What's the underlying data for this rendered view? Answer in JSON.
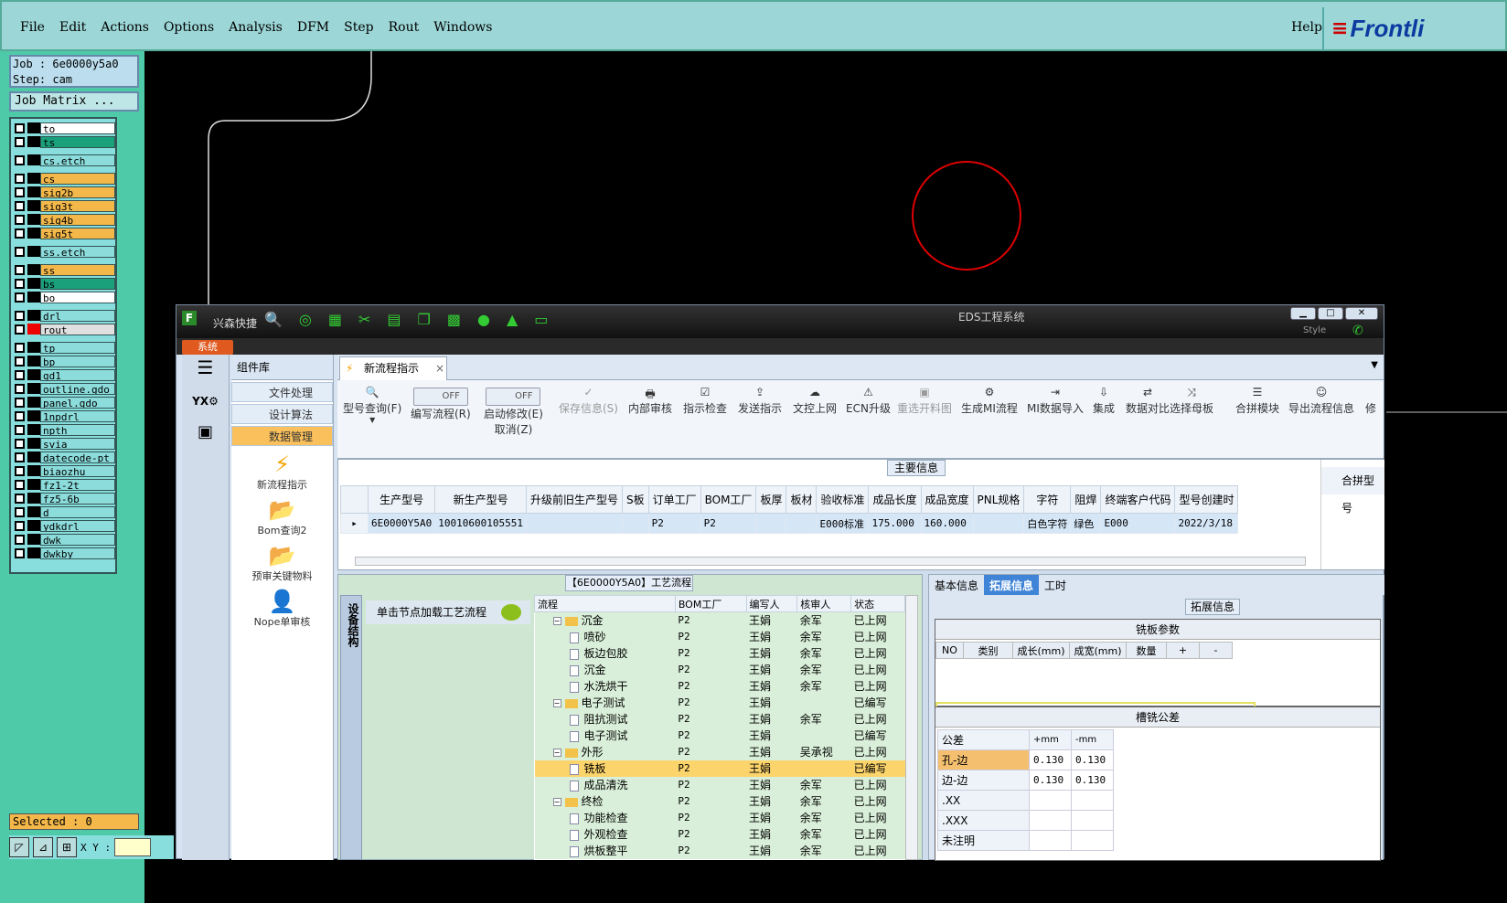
{
  "menubar": {
    "items": [
      "File",
      "Edit",
      "Actions",
      "Options",
      "Analysis",
      "DFM",
      "Step",
      "Rout",
      "Windows"
    ],
    "help": "Help",
    "logo": "Frontli"
  },
  "job": {
    "line1": "Job : 6e0000y5a0",
    "line2": "Step: cam",
    "matrix_button": "Job Matrix ..."
  },
  "layers": [
    {
      "name": "to",
      "color": "#ffffff"
    },
    {
      "name": "ts",
      "color": "#1aa07a"
    },
    {
      "name": "cs.etch",
      "color": "#8cdcdc"
    },
    {
      "name": "cs",
      "color": "#f4b84a"
    },
    {
      "name": "sig2b",
      "color": "#f4b84a"
    },
    {
      "name": "sig3t",
      "color": "#f4b84a"
    },
    {
      "name": "sig4b",
      "color": "#f4b84a"
    },
    {
      "name": "sig5t",
      "color": "#f4b84a"
    },
    {
      "name": "ss.etch",
      "color": "#8cdcdc"
    },
    {
      "name": "ss",
      "color": "#f4b84a"
    },
    {
      "name": "bs",
      "color": "#1aa07a"
    },
    {
      "name": "bo",
      "color": "#ffffff"
    },
    {
      "name": "drl",
      "color": "#8cdcdc"
    },
    {
      "name": "rout",
      "color": "#e0e0e0"
    },
    {
      "name": "tp",
      "color": "#8cdcdc"
    },
    {
      "name": "bp",
      "color": "#8cdcdc"
    },
    {
      "name": "gd1",
      "color": "#8cdcdc"
    },
    {
      "name": "outline.gdo",
      "color": "#8cdcdc"
    },
    {
      "name": "panel.gdo",
      "color": "#8cdcdc"
    },
    {
      "name": "1npdrl",
      "color": "#8cdcdc"
    },
    {
      "name": "npth",
      "color": "#8cdcdc"
    },
    {
      "name": "svia",
      "color": "#8cdcdc"
    },
    {
      "name": "datecode-pt",
      "color": "#8cdcdc"
    },
    {
      "name": "biaozhu",
      "color": "#8cdcdc"
    },
    {
      "name": "fz1-2t",
      "color": "#8cdcdc"
    },
    {
      "name": "fz5-6b",
      "color": "#8cdcdc"
    },
    {
      "name": "d",
      "color": "#8cdcdc"
    },
    {
      "name": "ydkdrl",
      "color": "#8cdcdc"
    },
    {
      "name": "dwk",
      "color": "#8cdcdc"
    },
    {
      "name": "dwkby",
      "color": "#8cdcdc"
    }
  ],
  "status": {
    "selected": "Selected : 0",
    "xy_label": "X Y :"
  },
  "eds": {
    "app_name": "兴森快捷",
    "title": "EDS工程系统",
    "sys_tab": "系统",
    "style_label": "Style",
    "complib": {
      "title": "组件库",
      "items": [
        "文件处理",
        "设计算法",
        "数据管理"
      ]
    },
    "bigbuttons": [
      "新流程指示",
      "Bom查询2",
      "预审关键物料",
      "Nope单审核"
    ],
    "doc_tab": "新流程指示",
    "ribbon": {
      "query": "型号查询(F)",
      "off1": "OFF",
      "edit_flow": "编写流程(R)",
      "off2": "OFF",
      "start_edit": "启动修改(E)",
      "cancel": "取消(Z)",
      "save": "保存信息(S)",
      "buttons": [
        "内部审核",
        "指示检查",
        "发送指示",
        "文控上网",
        "ECN升级",
        "重选开料图",
        "生成MI流程",
        "MI数据导入",
        "集成",
        "数据对比",
        "选择母板",
        "合拼模块",
        "导出流程信息",
        "修"
      ]
    },
    "main_info_label": "主要信息",
    "grid": {
      "headers": [
        "生产型号",
        "新生产型号",
        "升级前旧生产型号",
        "S板",
        "订单工厂",
        "BOM工厂",
        "板厚",
        "板材",
        "验收标准",
        "成品长度",
        "成品宽度",
        "PNL规格",
        "字符",
        "阻焊",
        "终端客户代码",
        "型号创建时"
      ],
      "row": [
        "6E0000Y5A0",
        "10010600105551",
        "",
        "",
        "P2",
        "P2",
        "",
        "",
        "E000标准",
        "175.000",
        "160.000",
        "",
        "白色字符",
        "绿色",
        "E000",
        "2022/3/18"
      ],
      "merge_header": "合拼型号"
    },
    "flow_label": "【6E0000Y5A0】工艺流程",
    "side_vert": "设备结构",
    "click_load": "单击节点加载工艺流程",
    "tree": {
      "headers": [
        "流程",
        "BOM工厂",
        "编写人",
        "核审人",
        "状态"
      ],
      "rows": [
        {
          "name": "沉金",
          "level": 0,
          "folder": true,
          "bom": "P2",
          "writer": "王娟",
          "reviewer": "余军",
          "status": "已上网"
        },
        {
          "name": "喷砂",
          "level": 1,
          "folder": false,
          "bom": "P2",
          "writer": "王娟",
          "reviewer": "余军",
          "status": "已上网"
        },
        {
          "name": "板边包胶",
          "level": 1,
          "folder": false,
          "bom": "P2",
          "writer": "王娟",
          "reviewer": "余军",
          "status": "已上网"
        },
        {
          "name": "沉金",
          "level": 1,
          "folder": false,
          "bom": "P2",
          "writer": "王娟",
          "reviewer": "余军",
          "status": "已上网"
        },
        {
          "name": "水洗烘干",
          "level": 1,
          "folder": false,
          "bom": "P2",
          "writer": "王娟",
          "reviewer": "余军",
          "status": "已上网"
        },
        {
          "name": "电子测试",
          "level": 0,
          "folder": true,
          "bom": "P2",
          "writer": "王娟",
          "reviewer": "",
          "status": "已编写"
        },
        {
          "name": "阻抗测试",
          "level": 1,
          "folder": false,
          "bom": "P2",
          "writer": "王娟",
          "reviewer": "余军",
          "status": "已上网"
        },
        {
          "name": "电子测试",
          "level": 1,
          "folder": false,
          "bom": "P2",
          "writer": "王娟",
          "reviewer": "",
          "status": "已编写"
        },
        {
          "name": "外形",
          "level": 0,
          "folder": true,
          "bom": "P2",
          "writer": "王娟",
          "reviewer": "吴承视",
          "status": "已上网"
        },
        {
          "name": "铣板",
          "level": 1,
          "folder": false,
          "bom": "P2",
          "writer": "王娟",
          "reviewer": "",
          "status": "已编写",
          "selected": true
        },
        {
          "name": "成品清洗",
          "level": 1,
          "folder": false,
          "bom": "P2",
          "writer": "王娟",
          "reviewer": "余军",
          "status": "已上网"
        },
        {
          "name": "终检",
          "level": 0,
          "folder": true,
          "bom": "P2",
          "writer": "王娟",
          "reviewer": "余军",
          "status": "已上网"
        },
        {
          "name": "功能检查",
          "level": 1,
          "folder": false,
          "bom": "P2",
          "writer": "王娟",
          "reviewer": "余军",
          "status": "已上网"
        },
        {
          "name": "外观检查",
          "level": 1,
          "folder": false,
          "bom": "P2",
          "writer": "王娟",
          "reviewer": "余军",
          "status": "已上网"
        },
        {
          "name": "烘板整平",
          "level": 1,
          "folder": false,
          "bom": "P2",
          "writer": "王娟",
          "reviewer": "余军",
          "status": "已上网"
        }
      ]
    },
    "right_tabs": [
      "基本信息",
      "拓展信息",
      "工时"
    ],
    "ext_label": "拓展信息",
    "mill": {
      "title": "铣板参数",
      "headers": [
        "NO",
        "类别",
        "成长(mm)",
        "成宽(mm)",
        "数量",
        "+",
        "-"
      ]
    },
    "tol": {
      "title": "槽铣公差",
      "header": [
        "公差",
        "+mm",
        "-mm"
      ],
      "rows": [
        [
          "孔-边",
          "0.130",
          "0.130"
        ],
        [
          "边-边",
          "0.130",
          "0.130"
        ],
        [
          ".XX",
          "",
          ""
        ],
        [
          ".XXX",
          "",
          ""
        ],
        [
          "未注明",
          "",
          ""
        ]
      ]
    }
  }
}
